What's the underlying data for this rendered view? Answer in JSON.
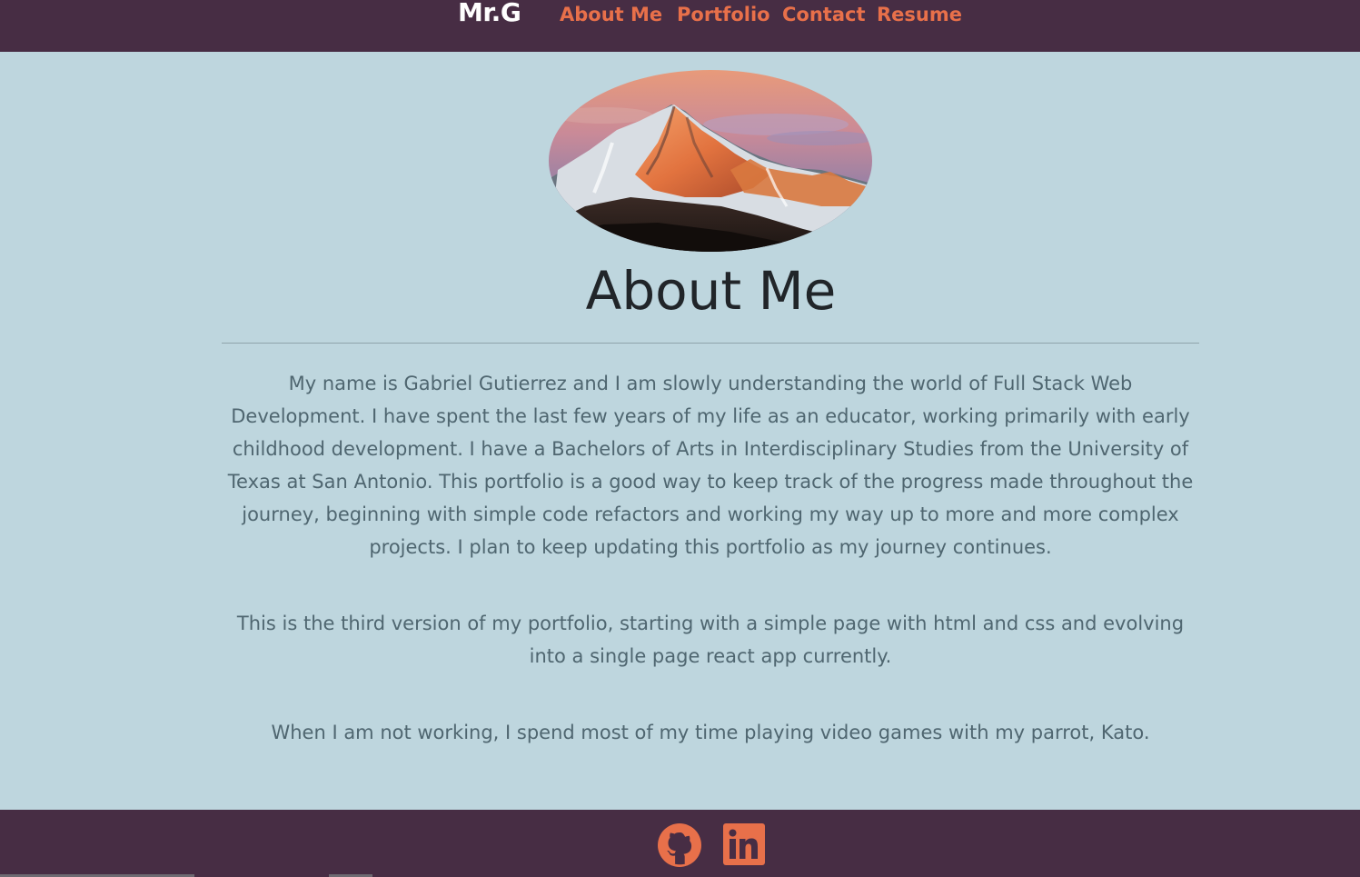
{
  "nav": {
    "brand": "Mr.G",
    "links": [
      {
        "label": "About Me"
      },
      {
        "label": "Portfolio"
      },
      {
        "label": "Contact"
      },
      {
        "label": "Resume"
      }
    ]
  },
  "hero": {
    "icon": "mountain-sunset-image"
  },
  "about": {
    "title": "About Me",
    "paragraphs": [
      "My name is Gabriel Gutierrez and I am slowly understanding the world of Full Stack Web Development. I have spent the last few years of my life as an educator, working primarily with early childhood development. I have a Bachelors of Arts in Interdisciplinary Studies from the University of Texas at San Antonio. This portfolio is a good way to keep track of the progress made throughout the journey, beginning with simple code refactors and working my way up to more and more complex projects. I plan to keep updating this portfolio as my journey continues.",
      "This is the third version of my portfolio, starting with a simple page with html and css and evolving into a single page react app currently.",
      "When I am not working, I spend most of my time playing video games with my parrot, Kato."
    ]
  },
  "footer": {
    "icons": [
      "github-icon",
      "linkedin-icon"
    ]
  },
  "colors": {
    "bar": "#472d44",
    "accent": "#e8704a",
    "page_bg": "#bed6de",
    "body_text": "#4f6670",
    "heading": "#212529"
  }
}
